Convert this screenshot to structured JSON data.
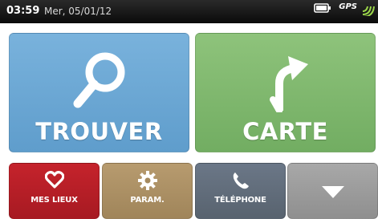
{
  "status": {
    "time": "03:59",
    "date": "Mer, 05/01/12",
    "gps_label": "GPS"
  },
  "main": {
    "trouver_label": "TROUVER",
    "carte_label": "CARTE"
  },
  "bottom": {
    "mes_lieux_label": "MES LIEUX",
    "param_label": "PARAM.",
    "telephone_label": "TÉLÉPHONE"
  },
  "colors": {
    "trouver": "#6aa6d3",
    "carte": "#7fb86d",
    "mes_lieux": "#b81f27",
    "param": "#ab9063",
    "telephone": "#616d7b",
    "more": "#9c9c9c"
  },
  "icons": {
    "trouver": "search-icon",
    "carte": "turn-right-arrow-icon",
    "mes_lieux": "heart-icon",
    "param": "gear-icon",
    "telephone": "phone-icon",
    "more": "chevron-down-icon",
    "battery": "battery-icon",
    "gps": "gps-signal-icon"
  }
}
